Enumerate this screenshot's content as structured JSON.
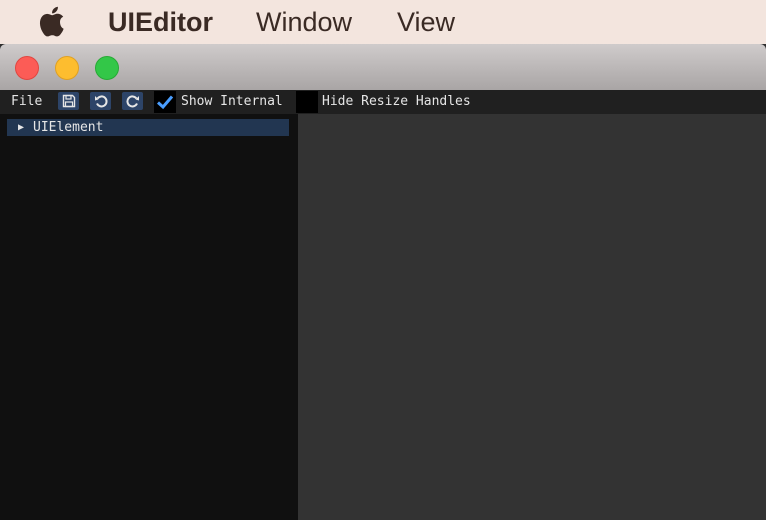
{
  "menubar": {
    "app_name": "UIEditor",
    "items": [
      "Window",
      "View"
    ]
  },
  "toolbar": {
    "file_label": "File",
    "save_icon": "save-icon",
    "undo_icon": "undo-icon",
    "redo_icon": "redo-icon",
    "show_internal": {
      "label": "Show Internal",
      "checked": true
    },
    "hide_resize_handles": {
      "label": "Hide Resize Handles",
      "checked": false
    }
  },
  "hierarchy": {
    "items": [
      {
        "label": "UIElement",
        "expanded": false,
        "selected": true
      }
    ]
  },
  "colors": {
    "accent": "#2d4468",
    "selection": "#223651",
    "check": "#4a9eff"
  }
}
